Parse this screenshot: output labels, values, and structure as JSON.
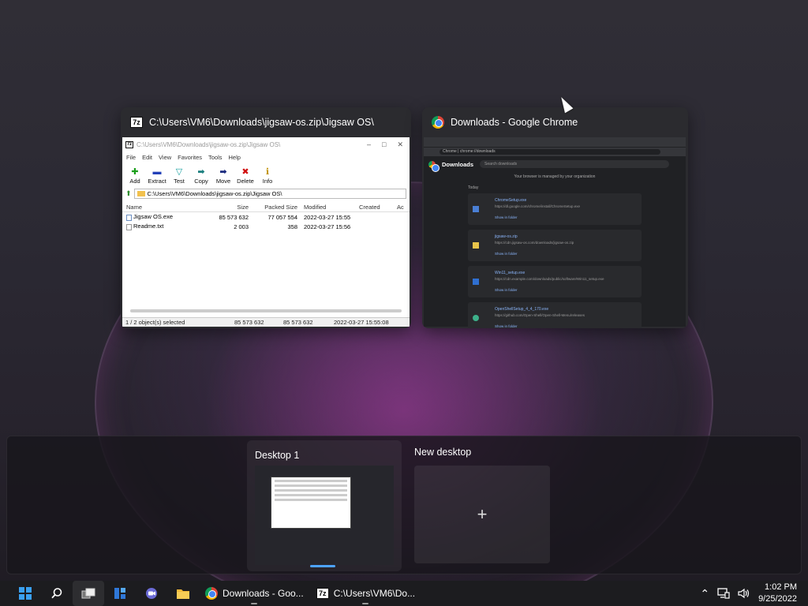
{
  "windows": {
    "zip": {
      "title": "C:\\Users\\VM6\\Downloads\\jigsaw-os.zip\\Jigsaw OS\\",
      "inner_title": "C:\\Users\\VM6\\Downloads\\jigsaw-os.zip\\Jigsaw OS\\",
      "menu": [
        "File",
        "Edit",
        "View",
        "Favorites",
        "Tools",
        "Help"
      ],
      "toolbar": [
        "Add",
        "Extract",
        "Test",
        "Copy",
        "Move",
        "Delete",
        "Info"
      ],
      "address": "C:\\Users\\VM6\\Downloads\\jigsaw-os.zip\\Jigsaw OS\\",
      "columns": [
        "Name",
        "Size",
        "Packed Size",
        "Modified",
        "Created",
        "Ac"
      ],
      "rows": [
        {
          "name": "Jigsaw OS.exe",
          "size": "85 573 632",
          "packed": "77 057 554",
          "modified": "2022-03-27 15:55"
        },
        {
          "name": "Readme.txt",
          "size": "2 003",
          "packed": "358",
          "modified": "2022-03-27 15:56"
        }
      ],
      "status": {
        "selected": "1 / 2 object(s) selected",
        "size": "85 573 632",
        "packed": "85 573 632",
        "modified": "2022-03-27 15:55:08"
      }
    },
    "chrome": {
      "title": "Downloads - Google Chrome",
      "page_heading": "Downloads",
      "search_placeholder": "Search downloads",
      "url": "Chrome | chrome://downloads",
      "managed_note": "Your browser is managed by your organization",
      "section": "Today",
      "items": [
        {
          "name": "ChromeSetup.exe",
          "url": "https://dl.google.com/chrome/install/ChromeSetup.exe",
          "action": "Show in folder"
        },
        {
          "name": "jigsaw-os.zip",
          "url": "https://cdn.jigsaw-os.com/downloads/jigsaw-os.zip",
          "action": "Show in folder"
        },
        {
          "name": "Win11_setup.exe",
          "url": "https://cdn.example.com/downloads/public/software/Win11_setup.exe",
          "action": "Show in folder"
        },
        {
          "name": "OpenShellSetup_4_4_170.exe",
          "url": "https://github.com/Open-Shell/Open-Shell-Menu/releases",
          "action": "Show in folder"
        }
      ]
    }
  },
  "desktops": {
    "desktop1": "Desktop 1",
    "new_desktop": "New desktop",
    "plus": "+"
  },
  "taskbar": {
    "apps": [
      {
        "label": "Downloads - Goo...",
        "icon": "chrome-icon"
      },
      {
        "label": "C:\\Users\\VM6\\Do...",
        "icon": "7zip-icon"
      }
    ],
    "time": "1:02 PM",
    "date": "9/25/2022",
    "colors": {
      "accent": "#3aa0f0",
      "indicator": "#4da3ff"
    }
  }
}
